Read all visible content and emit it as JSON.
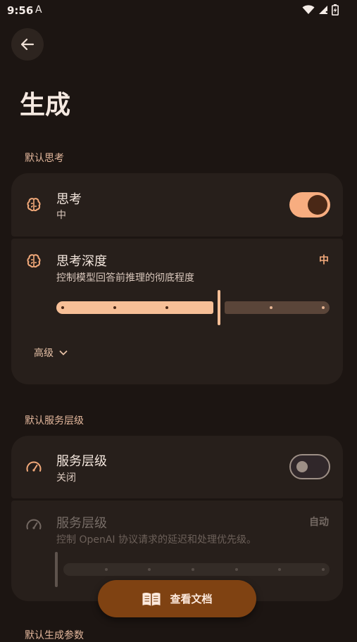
{
  "status_bar": {
    "time": "9:56",
    "notification_glyph": "A"
  },
  "page": {
    "title": "生成",
    "back_icon": "arrow-left-icon"
  },
  "sections": {
    "thinking": {
      "label": "默认思考",
      "toggle_row": {
        "title": "思考",
        "value": "中",
        "enabled": true,
        "icon": "brain-icon"
      },
      "depth_row": {
        "title": "思考深度",
        "description": "控制模型回答前推理的彻底程度",
        "value": "中",
        "icon": "brain-icon",
        "slider_levels": 6,
        "slider_selected_level": 3
      },
      "advanced_label": "高级"
    },
    "service_tier": {
      "label": "默认服务层级",
      "toggle_row": {
        "title": "服务层级",
        "value": "关闭",
        "enabled": false,
        "icon": "speedometer-icon"
      },
      "tier_row": {
        "title": "服务层级",
        "description": "控制 OpenAI 协议请求的延迟和处理优先级。",
        "value": "自动",
        "icon": "speedometer-icon",
        "slider_levels": 7,
        "slider_selected_level": 0
      }
    },
    "next_section_label": "默认生成参数"
  },
  "fab": {
    "label": "查看文档",
    "icon": "book-open-icon"
  },
  "colors": {
    "accent": "#f7ad80",
    "background": "#1c1512",
    "card": "#271f1b"
  }
}
